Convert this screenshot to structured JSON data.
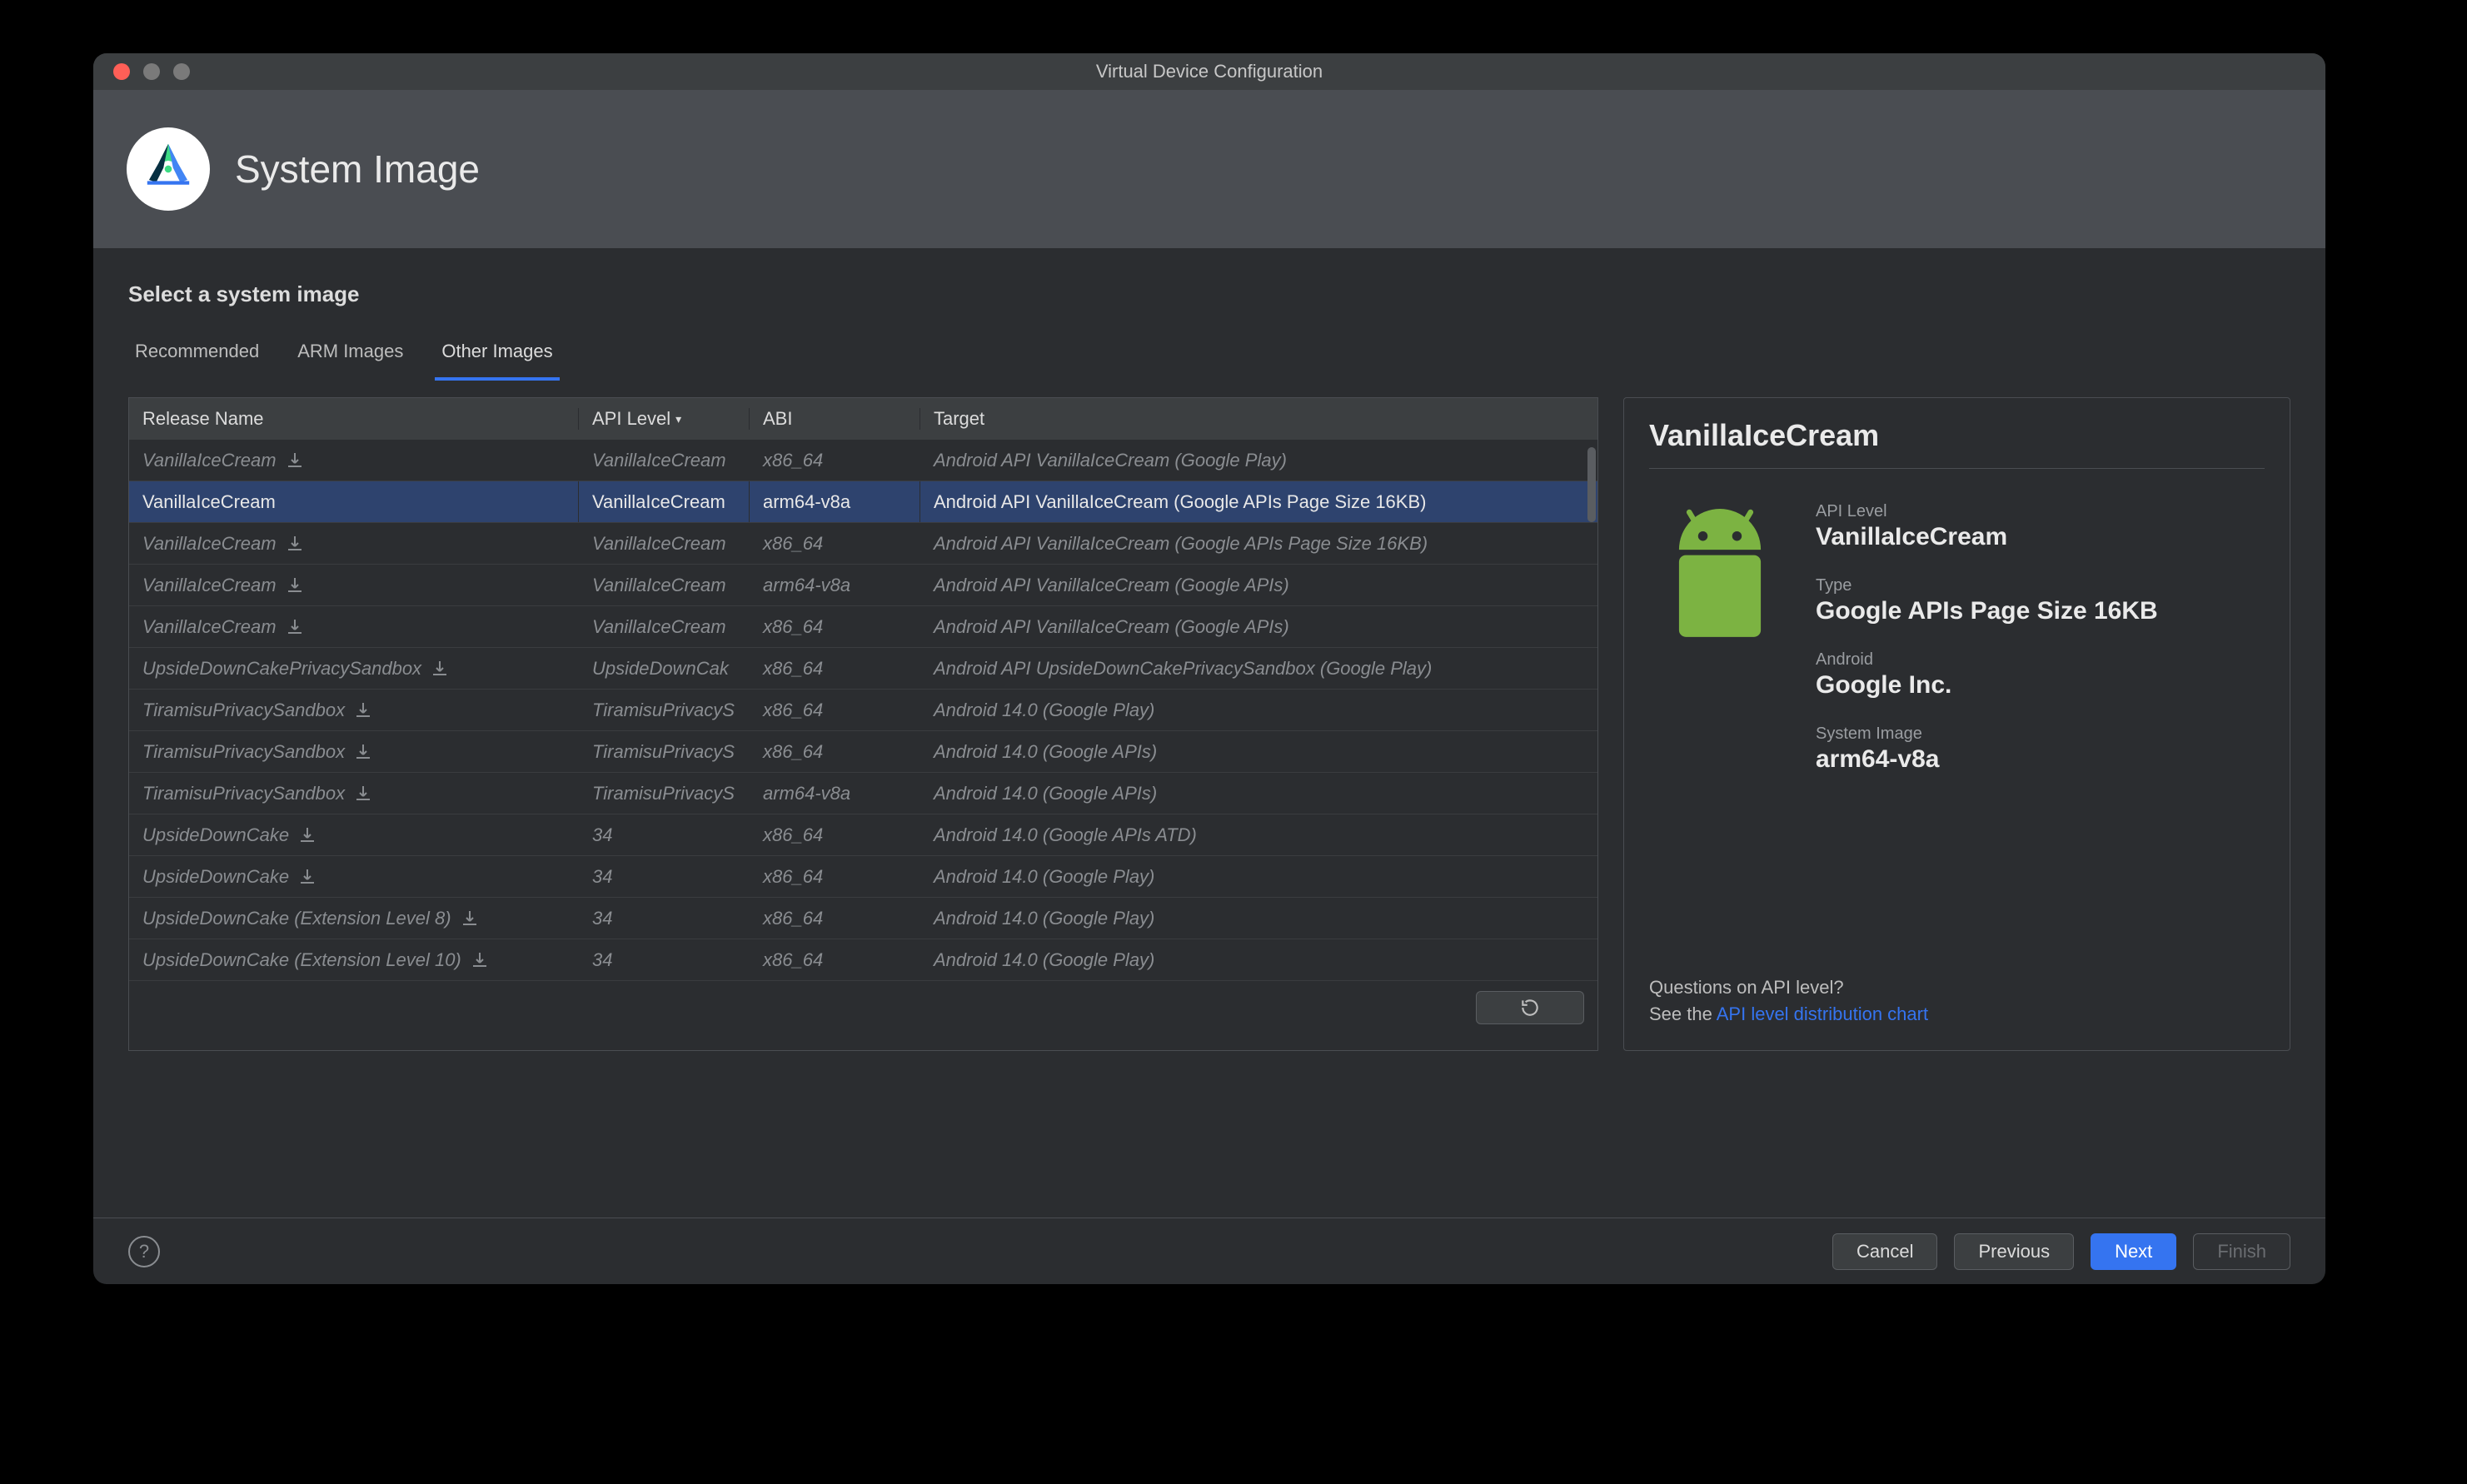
{
  "window": {
    "title": "Virtual Device Configuration"
  },
  "header": {
    "title": "System Image"
  },
  "subtitle": "Select a system image",
  "tabs": [
    {
      "label": "Recommended",
      "active": false
    },
    {
      "label": "ARM Images",
      "active": false
    },
    {
      "label": "Other Images",
      "active": true
    }
  ],
  "columns": {
    "release": "Release Name",
    "api": "API Level",
    "abi": "ABI",
    "target": "Target"
  },
  "rows": [
    {
      "release": "VanillaIceCream",
      "download": true,
      "api": "VanillaIceCream",
      "abi": "x86_64",
      "target": "Android API VanillaIceCream (Google Play)",
      "dim": true
    },
    {
      "release": "VanillaIceCream",
      "download": false,
      "api": "VanillaIceCream",
      "abi": "arm64-v8a",
      "target": "Android API VanillaIceCream (Google APIs Page Size 16KB)",
      "selected": true
    },
    {
      "release": "VanillaIceCream",
      "download": true,
      "api": "VanillaIceCream",
      "abi": "x86_64",
      "target": "Android API VanillaIceCream (Google APIs Page Size 16KB)",
      "dim": true
    },
    {
      "release": "VanillaIceCream",
      "download": true,
      "api": "VanillaIceCream",
      "abi": "arm64-v8a",
      "target": "Android API VanillaIceCream (Google APIs)",
      "dim": true
    },
    {
      "release": "VanillaIceCream",
      "download": true,
      "api": "VanillaIceCream",
      "abi": "x86_64",
      "target": "Android API VanillaIceCream (Google APIs)",
      "dim": true
    },
    {
      "release": "UpsideDownCakePrivacySandbox",
      "download": true,
      "api": "UpsideDownCak",
      "abi": "x86_64",
      "target": "Android API UpsideDownCakePrivacySandbox (Google Play)",
      "dim": true
    },
    {
      "release": "TiramisuPrivacySandbox",
      "download": true,
      "api": "TiramisuPrivacyS",
      "abi": "x86_64",
      "target": "Android 14.0 (Google Play)",
      "dim": true
    },
    {
      "release": "TiramisuPrivacySandbox",
      "download": true,
      "api": "TiramisuPrivacyS",
      "abi": "x86_64",
      "target": "Android 14.0 (Google APIs)",
      "dim": true
    },
    {
      "release": "TiramisuPrivacySandbox",
      "download": true,
      "api": "TiramisuPrivacyS",
      "abi": "arm64-v8a",
      "target": "Android 14.0 (Google APIs)",
      "dim": true
    },
    {
      "release": "UpsideDownCake",
      "download": true,
      "api": "34",
      "abi": "x86_64",
      "target": "Android 14.0 (Google APIs ATD)",
      "dim": true
    },
    {
      "release": "UpsideDownCake",
      "download": true,
      "api": "34",
      "abi": "x86_64",
      "target": "Android 14.0 (Google Play)",
      "dim": true
    },
    {
      "release": "UpsideDownCake (Extension Level 8)",
      "download": true,
      "api": "34",
      "abi": "x86_64",
      "target": "Android 14.0 (Google Play)",
      "dim": true
    },
    {
      "release": "UpsideDownCake (Extension Level 10)",
      "download": true,
      "api": "34",
      "abi": "x86_64",
      "target": "Android 14.0 (Google Play)",
      "dim": true
    }
  ],
  "detail": {
    "title": "VanillaIceCream",
    "apiLevelLabel": "API Level",
    "apiLevel": "VanillaIceCream",
    "typeLabel": "Type",
    "type": "Google APIs Page Size 16KB",
    "androidLabel": "Android",
    "android": "Google Inc.",
    "systemImageLabel": "System Image",
    "systemImage": "arm64-v8a",
    "question": "Questions on API level?",
    "seeThe": "See the ",
    "linkText": "API level distribution chart"
  },
  "buttons": {
    "cancel": "Cancel",
    "previous": "Previous",
    "next": "Next",
    "finish": "Finish"
  }
}
